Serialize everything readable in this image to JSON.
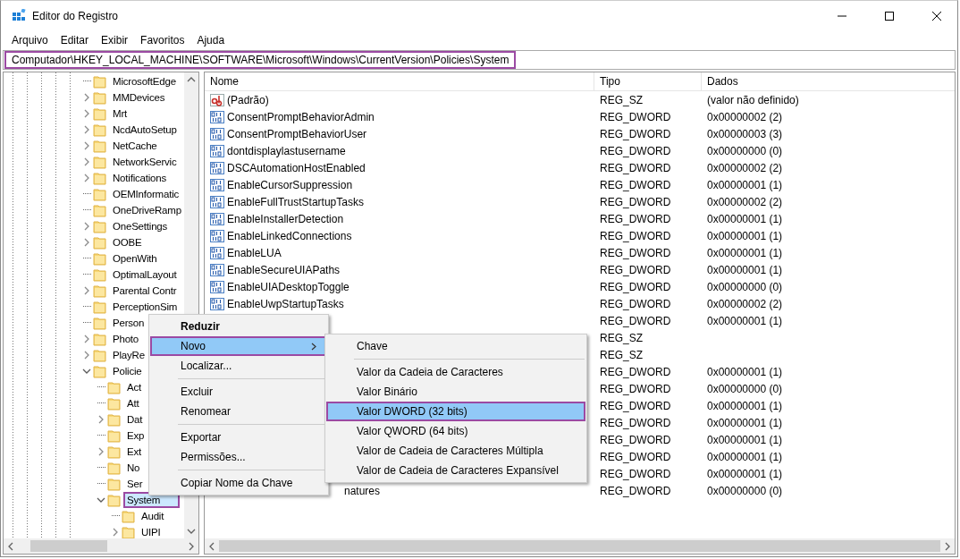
{
  "window": {
    "title": "Editor do Registro"
  },
  "menu_bar": [
    "Arquivo",
    "Editar",
    "Exibir",
    "Favoritos",
    "Ajuda"
  ],
  "address_bar": {
    "value": "Computador\\HKEY_LOCAL_MACHINE\\SOFTWARE\\Microsoft\\Windows\\CurrentVersion\\Policies\\System",
    "outlined": true
  },
  "tree": [
    {
      "label": "MicrosoftEdge",
      "expandable": false,
      "expanded": false,
      "selected": false,
      "outlined": false
    },
    {
      "label": "MMDevices",
      "expandable": true,
      "expanded": false,
      "selected": false,
      "outlined": false
    },
    {
      "label": "Mrt",
      "expandable": true,
      "expanded": false,
      "selected": false,
      "outlined": false
    },
    {
      "label": "NcdAutoSetup",
      "expandable": true,
      "expanded": false,
      "selected": false,
      "outlined": false
    },
    {
      "label": "NetCache",
      "expandable": true,
      "expanded": false,
      "selected": false,
      "outlined": false
    },
    {
      "label": "NetworkServic",
      "expandable": true,
      "expanded": false,
      "selected": false,
      "outlined": false
    },
    {
      "label": "Notifications",
      "expandable": true,
      "expanded": false,
      "selected": false,
      "outlined": false
    },
    {
      "label": "OEMInformatic",
      "expandable": false,
      "expanded": false,
      "selected": false,
      "outlined": false
    },
    {
      "label": "OneDriveRamp",
      "expandable": false,
      "expanded": false,
      "selected": false,
      "outlined": false
    },
    {
      "label": "OneSettings",
      "expandable": true,
      "expanded": false,
      "selected": false,
      "outlined": false
    },
    {
      "label": "OOBE",
      "expandable": true,
      "expanded": false,
      "selected": false,
      "outlined": false
    },
    {
      "label": "OpenWith",
      "expandable": false,
      "expanded": false,
      "selected": false,
      "outlined": false
    },
    {
      "label": "OptimalLayout",
      "expandable": false,
      "expanded": false,
      "selected": false,
      "outlined": false
    },
    {
      "label": "Parental Contr",
      "expandable": true,
      "expanded": false,
      "selected": false,
      "outlined": false
    },
    {
      "label": "PerceptionSim",
      "expandable": false,
      "expanded": false,
      "selected": false,
      "outlined": false
    },
    {
      "label": "Person",
      "expandable": false,
      "expanded": false,
      "selected": false,
      "outlined": false
    },
    {
      "label": "Photo",
      "expandable": true,
      "expanded": false,
      "selected": false,
      "outlined": false
    },
    {
      "label": "PlayRe",
      "expandable": true,
      "expanded": false,
      "selected": false,
      "outlined": false
    },
    {
      "label": "Policie",
      "expandable": true,
      "expanded": true,
      "selected": false,
      "outlined": false,
      "children": [
        {
          "label": "Act",
          "expandable": false,
          "expanded": false,
          "selected": false,
          "outlined": false
        },
        {
          "label": "Att",
          "expandable": false,
          "expanded": false,
          "selected": false,
          "outlined": false
        },
        {
          "label": "Dat",
          "expandable": true,
          "expanded": false,
          "selected": false,
          "outlined": false
        },
        {
          "label": "Exp",
          "expandable": false,
          "expanded": false,
          "selected": false,
          "outlined": false
        },
        {
          "label": "Ext",
          "expandable": true,
          "expanded": false,
          "selected": false,
          "outlined": false
        },
        {
          "label": "No",
          "expandable": false,
          "expanded": false,
          "selected": false,
          "outlined": false
        },
        {
          "label": "Ser",
          "expandable": false,
          "expanded": false,
          "selected": false,
          "outlined": false
        },
        {
          "label": "System",
          "expandable": true,
          "expanded": true,
          "selected": true,
          "outlined": true,
          "children": [
            {
              "label": "Audit",
              "expandable": false,
              "expanded": false,
              "selected": false,
              "outlined": false
            },
            {
              "label": "UIPI",
              "expandable": true,
              "expanded": false,
              "selected": false,
              "outlined": false
            }
          ]
        }
      ]
    }
  ],
  "values": {
    "columns": [
      "Nome",
      "Tipo",
      "Dados"
    ],
    "rows": [
      {
        "kind": "string",
        "name": "(Padrão)",
        "type": "REG_SZ",
        "data": "(valor não definido)"
      },
      {
        "kind": "binary",
        "name": "ConsentPromptBehaviorAdmin",
        "type": "REG_DWORD",
        "data": "0x00000002 (2)"
      },
      {
        "kind": "binary",
        "name": "ConsentPromptBehaviorUser",
        "type": "REG_DWORD",
        "data": "0x00000003 (3)"
      },
      {
        "kind": "binary",
        "name": "dontdisplaylastusername",
        "type": "REG_DWORD",
        "data": "0x00000000 (0)"
      },
      {
        "kind": "binary",
        "name": "DSCAutomationHostEnabled",
        "type": "REG_DWORD",
        "data": "0x00000002 (2)"
      },
      {
        "kind": "binary",
        "name": "EnableCursorSuppression",
        "type": "REG_DWORD",
        "data": "0x00000001 (1)"
      },
      {
        "kind": "binary",
        "name": "EnableFullTrustStartupTasks",
        "type": "REG_DWORD",
        "data": "0x00000002 (2)"
      },
      {
        "kind": "binary",
        "name": "EnableInstallerDetection",
        "type": "REG_DWORD",
        "data": "0x00000001 (1)"
      },
      {
        "kind": "binary",
        "name": "EnableLinkedConnections",
        "type": "REG_DWORD",
        "data": "0x00000001 (1)"
      },
      {
        "kind": "binary",
        "name": "EnableLUA",
        "type": "REG_DWORD",
        "data": "0x00000001 (1)"
      },
      {
        "kind": "binary",
        "name": "EnableSecureUIAPaths",
        "type": "REG_DWORD",
        "data": "0x00000001 (1)"
      },
      {
        "kind": "binary",
        "name": "EnableUIADesktopToggle",
        "type": "REG_DWORD",
        "data": "0x00000000 (0)"
      },
      {
        "kind": "binary",
        "name": "EnableUwpStartupTasks",
        "type": "REG_DWORD",
        "data": "0x00000002 (2)"
      },
      {
        "kind": "covered",
        "type": "REG_DWORD",
        "data": "0x00000001 (1)"
      },
      {
        "kind": "covered",
        "type": "REG_SZ"
      },
      {
        "kind": "covered",
        "type": "REG_SZ"
      },
      {
        "kind": "covered",
        "type": "REG_DWORD",
        "data": "0x00000001 (1)"
      },
      {
        "kind": "covered",
        "type": "REG_DWORD",
        "data": "0x00000000 (0)"
      },
      {
        "kind": "covered",
        "type": "REG_DWORD",
        "data": "0x00000001 (1)"
      },
      {
        "kind": "covered",
        "type": "REG_DWORD",
        "data": "0x00000001 (1)"
      },
      {
        "kind": "covered",
        "type": "REG_DWORD",
        "data": "0x00000001 (1)"
      },
      {
        "kind": "covered",
        "type": "REG_DWORD",
        "data": "0x00000001 (1)"
      },
      {
        "kind": "covered",
        "type": "REG_DWORD",
        "data": "0x00000001 (1)"
      },
      {
        "kind": "covered",
        "name": "natures",
        "type": "REG_DWORD",
        "data": "0x00000000 (0)"
      }
    ]
  },
  "context_menu": {
    "groups": [
      [
        {
          "label": "Reduzir",
          "default": true,
          "selected": false,
          "outlined": false,
          "submenu": false
        },
        {
          "label": "Novo",
          "default": false,
          "selected": true,
          "outlined": true,
          "submenu": true
        },
        {
          "label": "Localizar...",
          "default": false,
          "selected": false,
          "outlined": false,
          "submenu": false
        }
      ],
      [
        {
          "label": "Excluir",
          "default": false,
          "selected": false,
          "outlined": false,
          "submenu": false
        },
        {
          "label": "Renomear",
          "default": false,
          "selected": false,
          "outlined": false,
          "submenu": false
        }
      ],
      [
        {
          "label": "Exportar",
          "default": false,
          "selected": false,
          "outlined": false,
          "submenu": false
        },
        {
          "label": "Permissões...",
          "default": false,
          "selected": false,
          "outlined": false,
          "submenu": false
        }
      ],
      [
        {
          "label": "Copiar Nome da Chave",
          "default": false,
          "selected": false,
          "outlined": false,
          "submenu": false
        }
      ]
    ]
  },
  "submenu": {
    "groups": [
      [
        {
          "label": "Chave",
          "selected": false,
          "outlined": false
        }
      ],
      [
        {
          "label": "Valor da Cadeia de Caracteres",
          "selected": false,
          "outlined": false
        },
        {
          "label": "Valor Binário",
          "selected": false,
          "outlined": false
        },
        {
          "label": "Valor DWORD (32 bits)",
          "selected": true,
          "outlined": true
        },
        {
          "label": "Valor QWORD (64 bits)",
          "selected": false,
          "outlined": false
        },
        {
          "label": "Valor de Cadeia de Caracteres Múltipla",
          "selected": false,
          "outlined": false
        },
        {
          "label": "Valor de Cadeia de Caracteres Expansível",
          "selected": false,
          "outlined": false
        }
      ]
    ]
  }
}
